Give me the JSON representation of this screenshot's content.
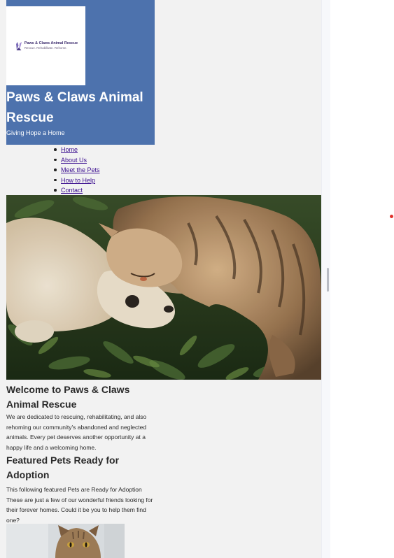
{
  "site": {
    "logo": {
      "name": "Paws & Claws Animal Rescue",
      "tagline": "Rescue. Rehabilitate. Rehome."
    },
    "title": "Paws & Claws Animal Rescue",
    "tagline": "Giving Hope a Home"
  },
  "nav": {
    "items": [
      {
        "label": "Home"
      },
      {
        "label": "About Us"
      },
      {
        "label": "Meet the Pets"
      },
      {
        "label": "How to Help"
      },
      {
        "label": "Contact"
      }
    ]
  },
  "hero": {
    "icon": "cat-and-dog-photo"
  },
  "welcome": {
    "heading": "Welcome to Paws & Claws Animal Rescue",
    "body": "We are dedicated to rescuing, rehabilitating, and also rehoming our community's abandoned and neglected animals. Every pet deserves another opportunity at a happy life and a welcoming home."
  },
  "featured": {
    "heading": "Featured Pets Ready for Adoption",
    "line1": "This following featured Pets are Ready for Adoption",
    "body": "These are just a few of our wonderful friends looking for their forever homes. Could it be you to help them find one?"
  },
  "colors": {
    "header_bg": "#4d72ad",
    "page_bg": "#f2f2f2",
    "link": "#3a0d8f"
  }
}
